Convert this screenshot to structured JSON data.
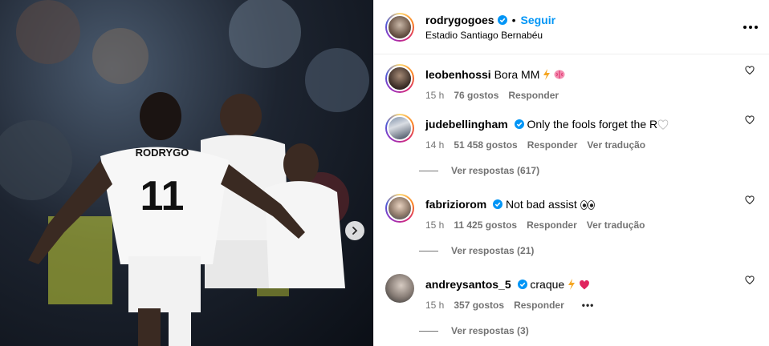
{
  "post": {
    "username": "rodrygogoes",
    "follow_label": "Seguir",
    "location": "Estadio Santiago Bernabéu",
    "jersey_name": "RODRYGO",
    "jersey_number": "11"
  },
  "comments": [
    {
      "username": "leobenhossi",
      "verified": false,
      "text": "Bora MM",
      "emoji": [
        "lightning",
        "brain"
      ],
      "time": "15 h",
      "likes": "76 gostos",
      "reply": "Responder",
      "translate": "",
      "replies": ""
    },
    {
      "username": "judebellingham",
      "verified": true,
      "text": "Only the fools forget the R",
      "emoji": [
        "white-heart"
      ],
      "time": "14 h",
      "likes": "51 458 gostos",
      "reply": "Responder",
      "translate": "Ver tradução",
      "replies": "Ver respostas (617)"
    },
    {
      "username": "fabriziorom",
      "verified": true,
      "text": "Not bad assist",
      "emoji": [
        "eyes"
      ],
      "time": "15 h",
      "likes": "11 425 gostos",
      "reply": "Responder",
      "translate": "Ver tradução",
      "replies": "Ver respostas (21)"
    },
    {
      "username": "andreysantos_5",
      "verified": true,
      "text": "craque",
      "emoji": [
        "lightning",
        "red-heart"
      ],
      "time": "15 h",
      "likes": "357 gostos",
      "reply": "Responder",
      "translate": "",
      "more": "•••",
      "replies": "Ver respostas (3)"
    }
  ],
  "colors": {
    "accent": "#0095f6",
    "muted": "#737373",
    "border": "#efefef"
  },
  "icons": {
    "verified": "verified-badge-icon",
    "like": "heart-outline-icon",
    "more": "more-options-icon",
    "next": "chevron-right-icon"
  }
}
